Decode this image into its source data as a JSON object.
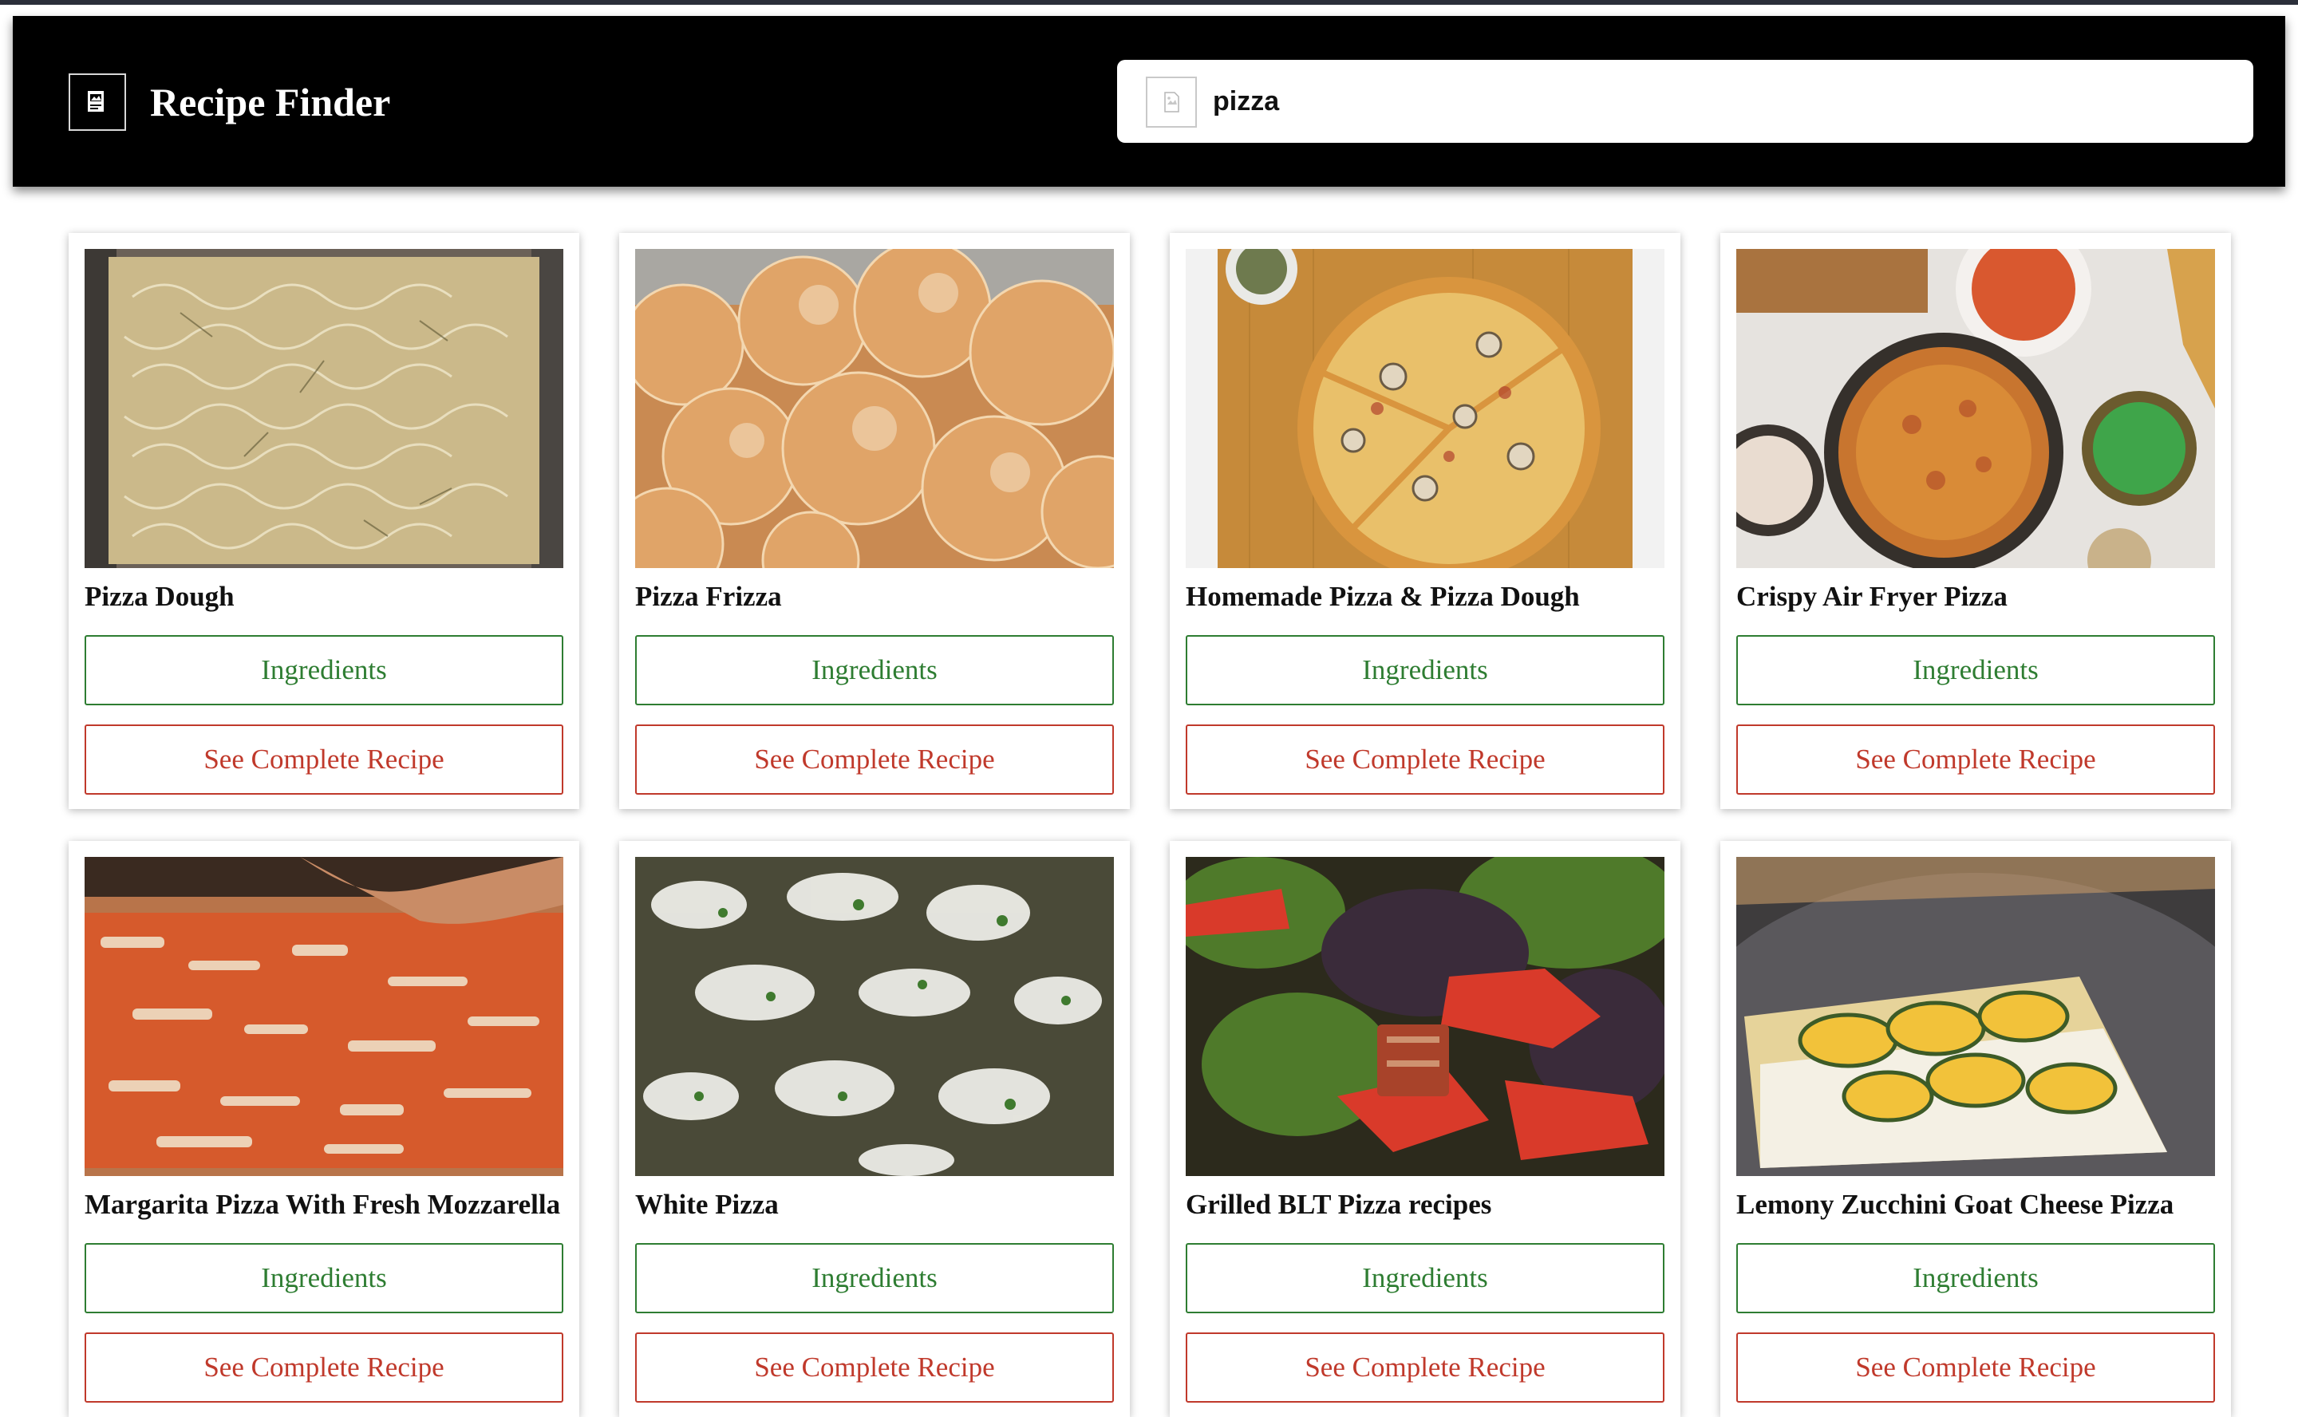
{
  "app": {
    "title": "Recipe Finder",
    "logo_icon": "broken-image-icon"
  },
  "search": {
    "value": "pizza",
    "icon": "broken-image-icon"
  },
  "colors": {
    "header_bg": "#000000",
    "ingredients_green": "#2e7d32",
    "recipe_red": "#c0392b"
  },
  "recipes": [
    {
      "title": "Pizza Dough",
      "ingredients_label": "Ingredients",
      "recipe_label": "See Complete Recipe"
    },
    {
      "title": "Pizza Frizza",
      "ingredients_label": "Ingredients",
      "recipe_label": "See Complete Recipe"
    },
    {
      "title": "Homemade Pizza & Pizza Dough",
      "ingredients_label": "Ingredients",
      "recipe_label": "See Complete Recipe"
    },
    {
      "title": "Crispy Air Fryer Pizza",
      "ingredients_label": "Ingredients",
      "recipe_label": "See Complete Recipe"
    },
    {
      "title": "Margarita Pizza With Fresh Mozzarella",
      "ingredients_label": "Ingredients",
      "recipe_label": "See Complete Recipe"
    },
    {
      "title": "White Pizza",
      "ingredients_label": "Ingredients",
      "recipe_label": "See Complete Recipe"
    },
    {
      "title": "Grilled BLT Pizza recipes",
      "ingredients_label": "Ingredients",
      "recipe_label": "See Complete Recipe"
    },
    {
      "title": "Lemony Zucchini Goat Cheese Pizza",
      "ingredients_label": "Ingredients",
      "recipe_label": "See Complete Recipe"
    }
  ]
}
